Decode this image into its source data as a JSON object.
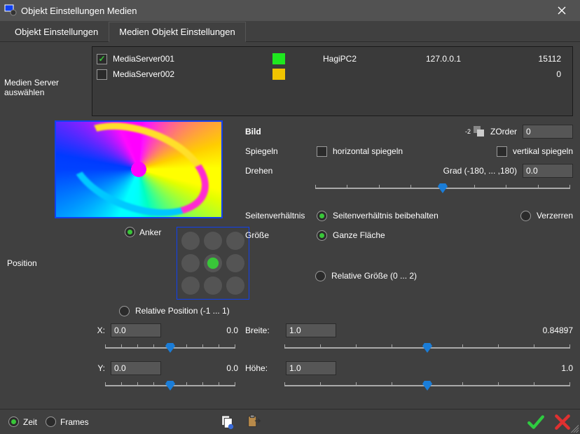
{
  "window": {
    "title": "Objekt Einstellungen  Medien"
  },
  "tabs": [
    {
      "label": "Objekt Einstellungen",
      "active": false
    },
    {
      "label": "Medien Objekt Einstellungen",
      "active": true
    }
  ],
  "servers": {
    "label": "Medien Server auswählen",
    "items": [
      {
        "checked": true,
        "name": "MediaServer001",
        "color": "#1ee81e",
        "host": "HagiPC2",
        "ip": "127.0.0.1",
        "port": "15112"
      },
      {
        "checked": false,
        "name": "MediaServer002",
        "color": "#f0c400",
        "host": "",
        "ip": "",
        "port": "0"
      }
    ]
  },
  "position": {
    "label": "Position",
    "anchor_label": "Anker",
    "anchor_on": true,
    "anchor_index": 4,
    "relative_label": "Relative Position (-1 ... 1)",
    "relative_on": false,
    "x_label": "X:",
    "x_value": "0.0",
    "x_readout": "0.0",
    "x_slider": 0.5,
    "y_label": "Y:",
    "y_value": "0.0",
    "y_readout": "0.0",
    "y_slider": 0.5
  },
  "image": {
    "header": "Bild",
    "zorder_label": "ZOrder",
    "zorder_value": "0",
    "mirror_label": "Spiegeln",
    "mirror_h_label": "horizontal spiegeln",
    "mirror_h_checked": false,
    "mirror_v_label": "vertikal spiegeln",
    "mirror_v_checked": false,
    "rotate_label": "Drehen",
    "rotate_unit": "Grad  (-180, ... ,180)",
    "rotate_value": "0.0",
    "rotate_slider": 0.5,
    "aspect_label": "Seitenverhältnis",
    "aspect_keep_label": "Seitenverhältnis beibehalten",
    "aspect_keep_on": true,
    "aspect_distort_label": "Verzerren",
    "aspect_distort_on": false,
    "size_label": "Größe",
    "size_full_label": "Ganze Fläche",
    "size_full_on": true,
    "size_rel_label": "Relative Größe (0 ...  2)",
    "size_rel_on": false,
    "width_label": "Breite:",
    "width_value": "1.0",
    "width_readout": "0.84897",
    "width_slider": 0.5,
    "height_label": "Höhe:",
    "height_value": "1.0",
    "height_readout": "1.0",
    "height_slider": 0.5
  },
  "footer": {
    "time_label": "Zeit",
    "time_on": true,
    "frames_label": "Frames",
    "frames_on": false
  }
}
